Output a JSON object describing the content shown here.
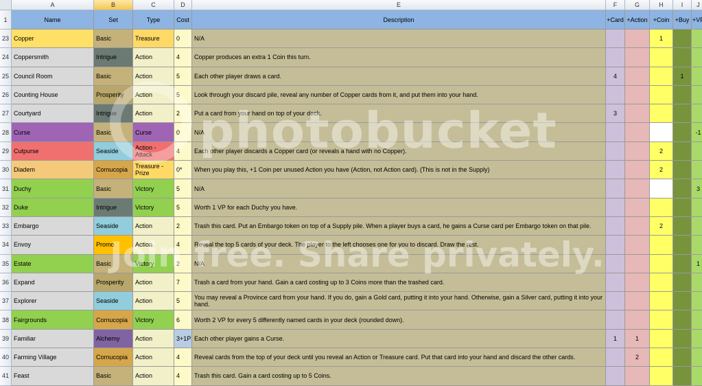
{
  "colors": {
    "header": "#8db4e2",
    "description": "#c4bd97",
    "card_col": "#ccc0da",
    "action_col": "#e6b8b7",
    "coin_col": "#ffff66",
    "buy_col": "#77933c",
    "vp_col": "#a9d96b"
  },
  "column_letters": [
    "A",
    "B",
    "C",
    "D",
    "E",
    "F",
    "G",
    "H",
    "I",
    "J"
  ],
  "headers": [
    "Name",
    "Set",
    "Type",
    "Cost",
    "Description",
    "+Card",
    "+Action",
    "+Coin",
    "+Buy",
    "+VP"
  ],
  "header_row_number": "1",
  "watermark": {
    "logo": "photobucket",
    "tagline": "Join free. Share privately."
  },
  "rows": [
    {
      "row": "23",
      "name": "Copper",
      "name_color": "#ffe066",
      "set": "Basic",
      "set_color": "#c4b27a",
      "type": "Treasure",
      "type_color": "#ffd966",
      "cost": "0",
      "desc": "N/A",
      "card": "",
      "action": "",
      "coin": "1",
      "buy": "",
      "vp": "",
      "coin_white": false
    },
    {
      "row": "24",
      "name": "Coppersmith",
      "name_color": "#d9d9d9",
      "set": "Intrigue",
      "set_color": "#6b7a73",
      "type": "Action",
      "type_color": "#f2f0c8",
      "cost": "4",
      "desc": "Copper produces an extra 1 Coin this turn.",
      "card": "",
      "action": "",
      "coin": "",
      "buy": "",
      "vp": "",
      "coin_white": false
    },
    {
      "row": "25",
      "name": "Council Room",
      "name_color": "#d9d9d9",
      "set": "Basic",
      "set_color": "#c4b27a",
      "type": "Action",
      "type_color": "#f2f0c8",
      "cost": "5",
      "desc": "Each other player draws a card.",
      "card": "4",
      "action": "",
      "coin": "",
      "buy": "1",
      "vp": "",
      "coin_white": false
    },
    {
      "row": "26",
      "name": "Counting House",
      "name_color": "#d9d9d9",
      "set": "Prosperity",
      "set_color": "#b8a66a",
      "type": "Action",
      "type_color": "#f2f0c8",
      "cost": "5",
      "desc": "Look through your discard pile, reveal any number of Copper cards from it, and put them into your hand.",
      "card": "",
      "action": "",
      "coin": "",
      "buy": "",
      "vp": "",
      "coin_white": false
    },
    {
      "row": "27",
      "name": "Courtyard",
      "name_color": "#d9d9d9",
      "set": "Intrigue",
      "set_color": "#6b7a73",
      "type": "Action",
      "type_color": "#f2f0c8",
      "cost": "2",
      "desc": "Put a card from your hand on top of your deck.",
      "card": "3",
      "action": "",
      "coin": "",
      "buy": "",
      "vp": "",
      "coin_white": false
    },
    {
      "row": "28",
      "name": "Curse",
      "name_color": "#a064b4",
      "set": "Basic",
      "set_color": "#c4b27a",
      "type": "Curse",
      "type_color": "#a064b4",
      "cost": "0",
      "desc": "N/A",
      "card": "",
      "action": "",
      "coin": "",
      "buy": "",
      "vp": "-1",
      "coin_white": true
    },
    {
      "row": "29",
      "name": "Cutpurse",
      "name_color": "#f07070",
      "set": "Seaside",
      "set_color": "#92cddc",
      "type": "Action - Attack",
      "type_color": "#f07070",
      "cost": "4",
      "desc": "Each other player discards a Copper card (or reveals a hand with no Copper).",
      "card": "",
      "action": "",
      "coin": "2",
      "buy": "",
      "vp": "",
      "coin_white": false
    },
    {
      "row": "30",
      "name": "Diadem",
      "name_color": "#f5c97a",
      "set": "Cornucopia",
      "set_color": "#d6a64a",
      "type": "Treasure - Prize",
      "type_color": "#ffd966",
      "cost": "0*",
      "desc": "When you play this, +1 Coin per unused Action you have (Action, not Action card). (This is not in the Supply)",
      "card": "",
      "action": "",
      "coin": "2",
      "buy": "",
      "vp": "",
      "coin_white": false
    },
    {
      "row": "31",
      "name": "Duchy",
      "name_color": "#92d050",
      "set": "Basic",
      "set_color": "#c4b27a",
      "type": "Victory",
      "type_color": "#92d050",
      "cost": "5",
      "desc": "N/A",
      "card": "",
      "action": "",
      "coin": "",
      "buy": "",
      "vp": "3",
      "coin_white": true
    },
    {
      "row": "32",
      "name": "Duke",
      "name_color": "#92d050",
      "set": "Intrigue",
      "set_color": "#6b7a73",
      "type": "Victory",
      "type_color": "#92d050",
      "cost": "5",
      "desc": "Worth 1 VP for each Duchy you have.",
      "card": "",
      "action": "",
      "coin": "",
      "buy": "",
      "vp": "",
      "coin_white": false
    },
    {
      "row": "33",
      "name": "Embargo",
      "name_color": "#d9d9d9",
      "set": "Seaside",
      "set_color": "#92cddc",
      "type": "Action",
      "type_color": "#f2f0c8",
      "cost": "2",
      "desc": "Trash this card. Put an Embargo token on top of a Supply pile. When a player buys a card, he gains a Curse card per Embargo token on that pile.",
      "card": "",
      "action": "",
      "coin": "2",
      "buy": "",
      "vp": "",
      "coin_white": false
    },
    {
      "row": "34",
      "name": "Envoy",
      "name_color": "#d9d9d9",
      "set": "Promo",
      "set_color": "#ffc000",
      "type": "Action",
      "type_color": "#f2f0c8",
      "cost": "4",
      "desc": "Reveal the top 5 cards of your deck. The player to the left chooses one for you to discard. Draw the rest.",
      "card": "",
      "action": "",
      "coin": "",
      "buy": "",
      "vp": "",
      "coin_white": false
    },
    {
      "row": "35",
      "name": "Estate",
      "name_color": "#92d050",
      "set": "Basic",
      "set_color": "#c4b27a",
      "type": "Victory",
      "type_color": "#92d050",
      "cost": "2",
      "desc": "N/A",
      "card": "",
      "action": "",
      "coin": "",
      "buy": "",
      "vp": "1",
      "coin_white": false
    },
    {
      "row": "36",
      "name": "Expand",
      "name_color": "#d9d9d9",
      "set": "Prosperity",
      "set_color": "#b8a66a",
      "type": "Action",
      "type_color": "#f2f0c8",
      "cost": "7",
      "desc": "Trash a card from your hand. Gain a card costing up to 3 Coins more than the trashed card.",
      "card": "",
      "action": "",
      "coin": "",
      "buy": "",
      "vp": "",
      "coin_white": false
    },
    {
      "row": "37",
      "name": "Explorer",
      "name_color": "#d9d9d9",
      "set": "Seaside",
      "set_color": "#92cddc",
      "type": "Action",
      "type_color": "#f2f0c8",
      "cost": "5",
      "desc": "You may reveal a Province card from your hand. If you do, gain a Gold card, putting it into your hand. Otherwise, gain a Silver card, putting it into your hand.",
      "card": "",
      "action": "",
      "coin": "",
      "buy": "",
      "vp": "",
      "coin_white": false,
      "wrap": true
    },
    {
      "row": "38",
      "name": "Fairgrounds",
      "name_color": "#92d050",
      "set": "Cornucopia",
      "set_color": "#d6a64a",
      "type": "Victory",
      "type_color": "#92d050",
      "cost": "6",
      "desc": "Worth 2 VP for every 5 differently named cards in your deck (rounded down).",
      "card": "",
      "action": "",
      "coin": "",
      "buy": "",
      "vp": "",
      "coin_white": false
    },
    {
      "row": "39",
      "name": "Familiar",
      "name_color": "#d9d9d9",
      "set": "Alchemy",
      "set_color": "#8064a2",
      "type": "Action",
      "type_color": "#f2f0c8",
      "cost": "3+1P",
      "desc": "Each other player gains a Curse.",
      "card": "1",
      "action": "1",
      "coin": "",
      "buy": "",
      "vp": "",
      "coin_white": false,
      "cost_color": "#b8cce4"
    },
    {
      "row": "40",
      "name": "Farming Village",
      "name_color": "#d9d9d9",
      "set": "Cornucopia",
      "set_color": "#d6a64a",
      "type": "Action",
      "type_color": "#f2f0c8",
      "cost": "4",
      "desc": "Reveal cards from the top of your deck until you reveal an Action or Treasure card. Put that card into your hand and discard the other cards.",
      "card": "",
      "action": "2",
      "coin": "",
      "buy": "",
      "vp": "",
      "coin_white": false
    },
    {
      "row": "41",
      "name": "Feast",
      "name_color": "#d9d9d9",
      "set": "Basic",
      "set_color": "#c4b27a",
      "type": "Action",
      "type_color": "#f2f0c8",
      "cost": "4",
      "desc": "Trash this card. Gain a card costing up to 5 Coins.",
      "card": "",
      "action": "",
      "coin": "",
      "buy": "",
      "vp": "",
      "coin_white": false
    }
  ]
}
